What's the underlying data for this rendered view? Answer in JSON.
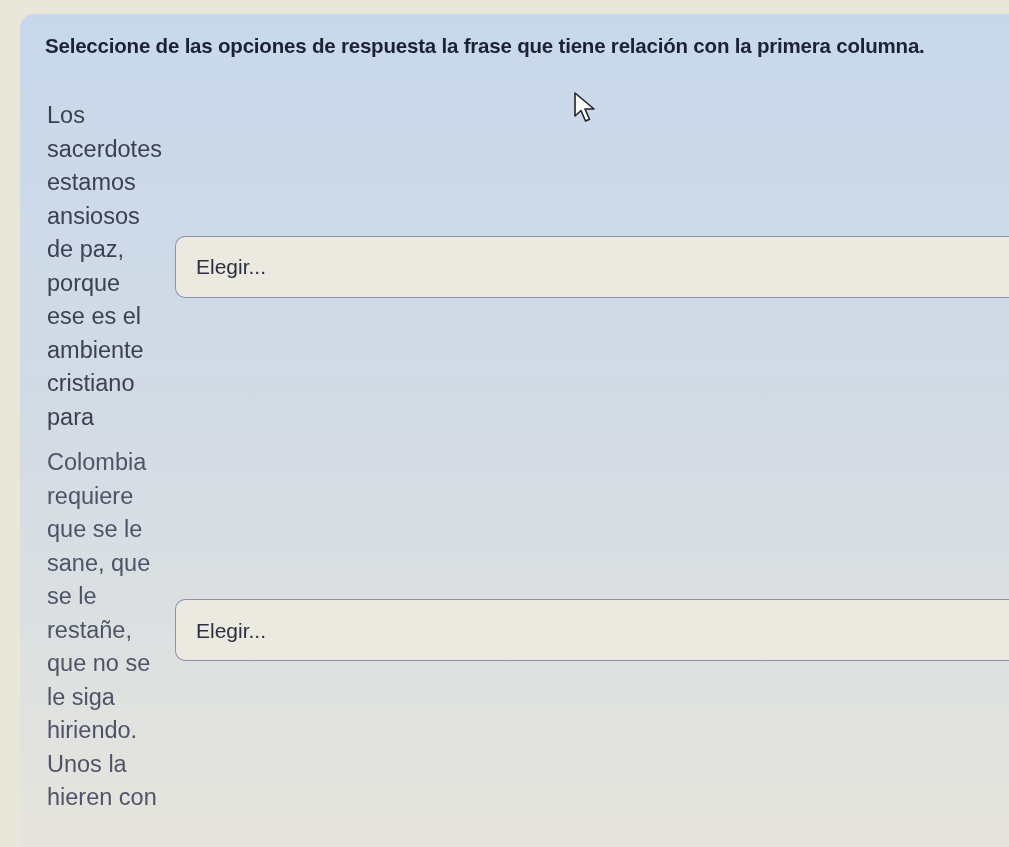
{
  "instruction": "Seleccione de las opciones de respuesta la frase que tiene relación con la primera columna.",
  "questions": [
    {
      "text": "Los sacerdotes estamos ansiosos de paz, porque ese es el ambiente cristiano para",
      "choice": "Elegir..."
    },
    {
      "text": "Colombia requiere que se le sane, que se le restañe, que no se le siga hiriendo. Unos la hieren con",
      "choice": "Elegir..."
    }
  ]
}
